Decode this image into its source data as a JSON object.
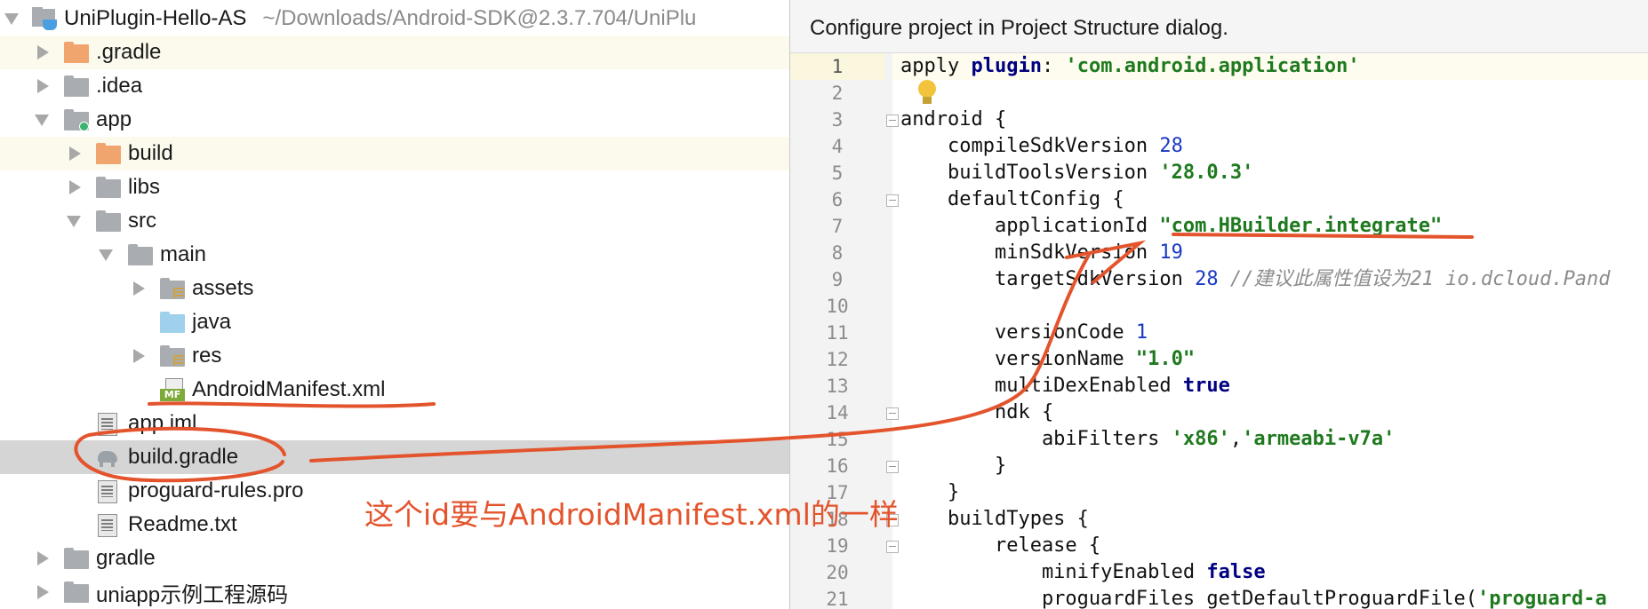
{
  "tree": {
    "root_name": "UniPlugin-Hello-AS",
    "root_path": "~/Downloads/Android-SDK@2.3.7.704/UniPlu",
    "items": [
      {
        "label": ".gradle"
      },
      {
        "label": ".idea"
      },
      {
        "label": "app"
      },
      {
        "label": "build"
      },
      {
        "label": "libs"
      },
      {
        "label": "src"
      },
      {
        "label": "main"
      },
      {
        "label": "assets"
      },
      {
        "label": "java"
      },
      {
        "label": "res"
      },
      {
        "label": "AndroidManifest.xml"
      },
      {
        "label": "app.iml"
      },
      {
        "label": "build.gradle"
      },
      {
        "label": "proguard-rules.pro"
      },
      {
        "label": "Readme.txt"
      },
      {
        "label": "gradle"
      },
      {
        "label": "uniapp示例工程源码"
      }
    ],
    "manifest_badge": "MF"
  },
  "editor": {
    "banner": "Configure project in Project Structure dialog.",
    "line_numbers": [
      "1",
      "2",
      "3",
      "4",
      "5",
      "6",
      "7",
      "8",
      "9",
      "10",
      "11",
      "12",
      "13",
      "14",
      "15",
      "16",
      "17",
      "18",
      "19",
      "20",
      "21"
    ],
    "lines": [
      {
        "t1": "apply ",
        "k1": "plugin",
        "t2": ": ",
        "s1": "'com.android.application'"
      },
      {},
      {
        "t1": "android {"
      },
      {
        "t1": "    compileSdkVersion ",
        "n1": "28"
      },
      {
        "t1": "    buildToolsVersion ",
        "s1": "'28.0.3'"
      },
      {
        "t1": "    defaultConfig {"
      },
      {
        "t1": "        applicationId ",
        "s1": "\"com.HBuilder.integrate\""
      },
      {
        "t1": "        minSdkVersion ",
        "n1": "19"
      },
      {
        "t1": "        targetSdkVersion ",
        "n1": "28",
        "c1": " //建议此属性值设为21 io.dcloud.Pand"
      },
      {},
      {
        "t1": "        versionCode ",
        "n1": "1"
      },
      {
        "t1": "        versionName ",
        "s1": "\"1.0\""
      },
      {
        "t1": "        multiDexEnabled ",
        "k1": "true"
      },
      {
        "t1": "        ndk {"
      },
      {
        "t1": "            abiFilters ",
        "s1": "'x86'",
        "t2": ",",
        "s2": "'armeabi-v7a'"
      },
      {
        "t1": "        }"
      },
      {
        "t1": "    }"
      },
      {
        "t1": "    buildTypes {"
      },
      {
        "t1": "        release {"
      },
      {
        "t1": "            minifyEnabled ",
        "k1": "false"
      },
      {
        "t1": "            proguardFiles getDefaultProguardFile(",
        "s1": "'proguard-a"
      }
    ]
  },
  "annotation": {
    "text": "这个id要与AndroidManifest.xml的一样",
    "color": "#e3542d"
  },
  "colors": {
    "string": "#1f7a1f",
    "keyword": "#000080",
    "number": "#1a38c4",
    "selected_row": "#d5d5d5",
    "excluded_row": "#fcfaed"
  }
}
